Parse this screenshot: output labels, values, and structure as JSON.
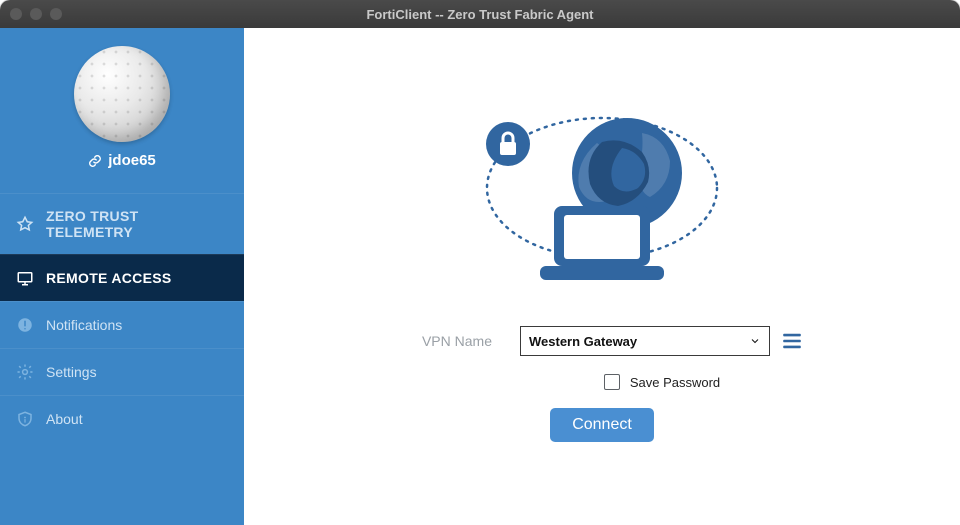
{
  "window": {
    "title": "FortiClient -- Zero Trust Fabric Agent"
  },
  "profile": {
    "username": "jdoe65"
  },
  "nav": {
    "zero_trust_label": "ZERO TRUST TELEMETRY",
    "remote_access_label": "REMOTE ACCESS",
    "notifications_label": "Notifications",
    "settings_label": "Settings",
    "about_label": "About"
  },
  "form": {
    "vpn_name_label": "VPN Name",
    "vpn_name_value": "Western Gateway",
    "save_password_label": "Save Password",
    "connect_label": "Connect"
  },
  "colors": {
    "sidebar": "#3c86c6",
    "active": "#0a2a4a",
    "accent": "#3166a0"
  }
}
